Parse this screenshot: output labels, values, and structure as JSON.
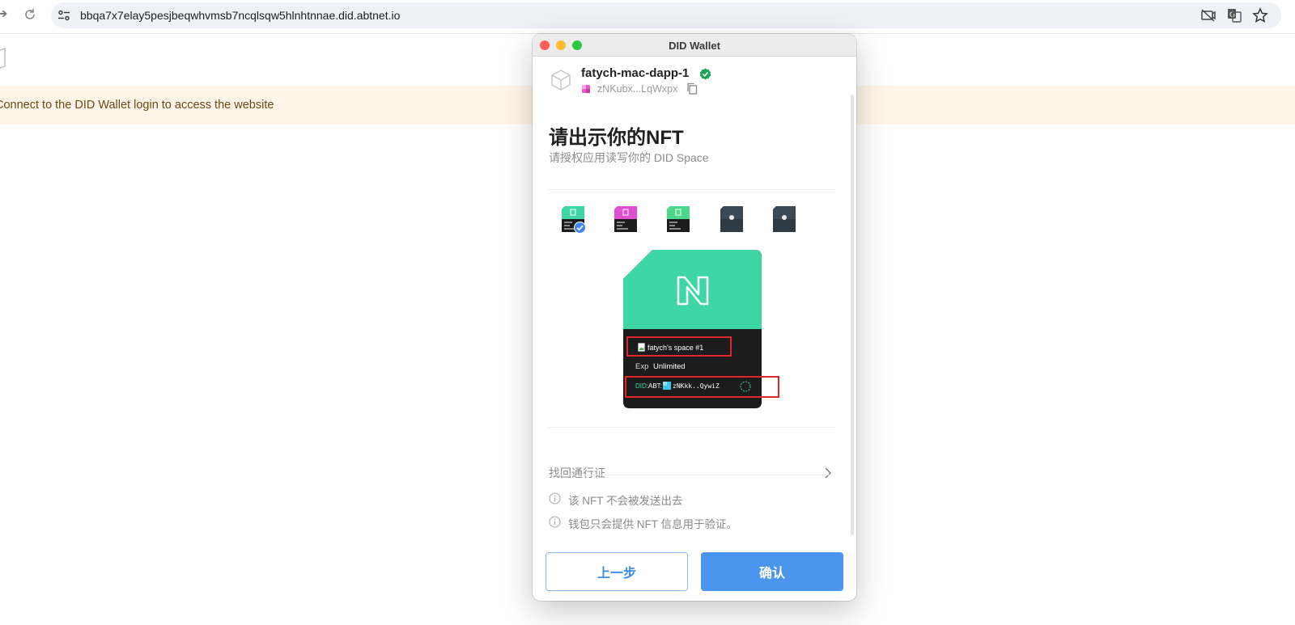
{
  "browser": {
    "url": "bbqa7x7elay5pesjbeqwhvmsb7ncqlsqw5hlnhtnnae.did.abtnet.io",
    "icons": [
      "forward-icon",
      "reload-icon",
      "site-info-icon",
      "camera-off-icon",
      "translate-icon",
      "bookmark-star-icon"
    ]
  },
  "page": {
    "banner_text": "Connect to the DID Wallet login to access the website",
    "banner_color": "#fff5e9"
  },
  "wallet": {
    "window_title": "DID Wallet",
    "app_name": "fatych-mac-dapp-1",
    "app_did_short": "zNKubx...LqWxpx",
    "title": "请出示你的NFT",
    "subtitle": "请授权应用读写你的 DID Space",
    "nft_thumbnails": [
      {
        "style": "green",
        "selected": true
      },
      {
        "style": "magenta",
        "selected": false
      },
      {
        "style": "green-light",
        "selected": false
      },
      {
        "style": "dark",
        "selected": false
      },
      {
        "style": "dark",
        "selected": false
      }
    ],
    "nft_card": {
      "name": "fatych's space #1",
      "exp_label": "Exp",
      "exp_value": "Unlimited",
      "did_label": "DID:ABT:",
      "did_value": "zNKkk..QywiZ"
    },
    "recover_label": "找回通行证",
    "notes": [
      "该 NFT 不会被发送出去",
      "钱包只会提供 NFT 信息用于验证。"
    ],
    "back_label": "上一步",
    "confirm_label": "确认",
    "colors": {
      "accent": "#4b95ef",
      "nft_green": "#3ed6a5",
      "highlight": "#e0262a",
      "verified": "#1fa25a"
    }
  }
}
